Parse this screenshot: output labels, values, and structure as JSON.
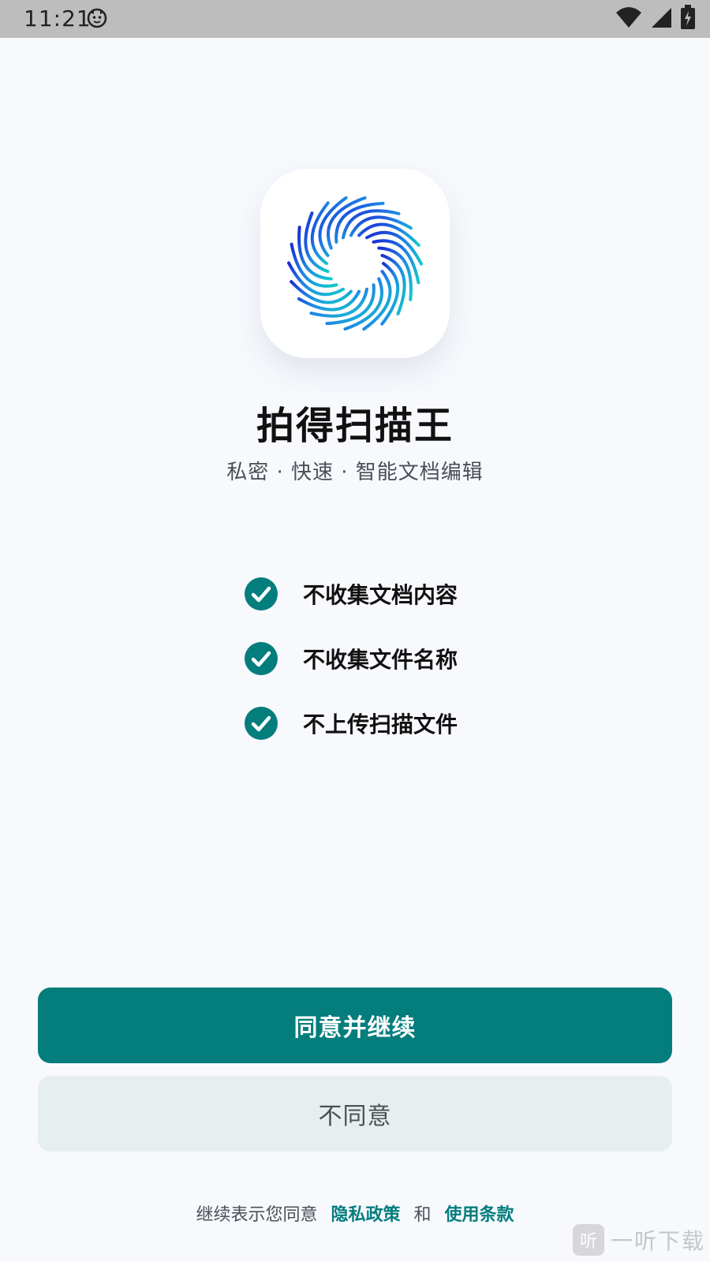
{
  "status_bar": {
    "time": "11:21",
    "icons": [
      "notification-cat-icon",
      "wifi-icon",
      "cell-signal-icon",
      "battery-charging-icon"
    ]
  },
  "app": {
    "icon": "swirl-logo-icon",
    "title": "拍得扫描王",
    "tagline": "私密 · 快速 · 智能文档编辑"
  },
  "features": [
    {
      "icon": "check-circle-icon",
      "label": "不收集文档内容"
    },
    {
      "icon": "check-circle-icon",
      "label": "不收集文件名称"
    },
    {
      "icon": "check-circle-icon",
      "label": "不上传扫描文件"
    }
  ],
  "buttons": {
    "agree_label": "同意并继续",
    "decline_label": "不同意"
  },
  "footer": {
    "prefix": "继续表示您同意",
    "privacy_link": "隐私政策",
    "conjunction": "和",
    "terms_link": "使用条款"
  },
  "watermark": {
    "logo_glyph": "听",
    "text": "一听下载"
  },
  "colors": {
    "accent": "#047d7d",
    "background": "#f7f9fd",
    "secondary_button": "#e6efee"
  }
}
